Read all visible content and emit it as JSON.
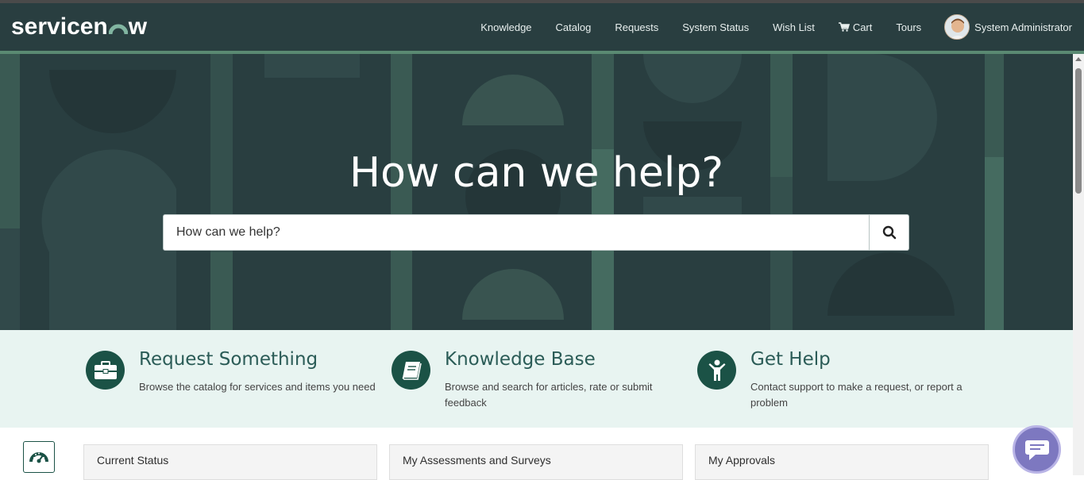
{
  "brand": {
    "logo_text_pre": "servicen",
    "logo_text_post": "w"
  },
  "nav": {
    "items": [
      {
        "label": "Knowledge"
      },
      {
        "label": "Catalog"
      },
      {
        "label": "Requests"
      },
      {
        "label": "System Status"
      },
      {
        "label": "Wish List"
      },
      {
        "label": "Cart",
        "icon": "cart-icon"
      },
      {
        "label": "Tours"
      }
    ],
    "user_name": "System Administrator"
  },
  "hero": {
    "title": "How can we help?",
    "search_placeholder": "How can we help?",
    "search_icon": "search-icon"
  },
  "promo": [
    {
      "title": "Request Something",
      "description": "Browse the catalog for services and items you need",
      "icon": "briefcase-icon"
    },
    {
      "title": "Knowledge Base",
      "description": "Browse and search for articles, rate or submit feedback",
      "icon": "book-icon"
    },
    {
      "title": "Get Help",
      "description": "Contact support to make a request, or report a problem",
      "icon": "person-icon"
    }
  ],
  "widgets": [
    {
      "title": "Current Status"
    },
    {
      "title": "My Assessments and Surveys"
    },
    {
      "title": "My Approvals"
    }
  ],
  "colors": {
    "navbar": "#293e40",
    "accent": "#5a8a72",
    "promo_bg": "#e8f4f1",
    "icon_circle": "#1b5246",
    "chat": "#7d78c0"
  }
}
